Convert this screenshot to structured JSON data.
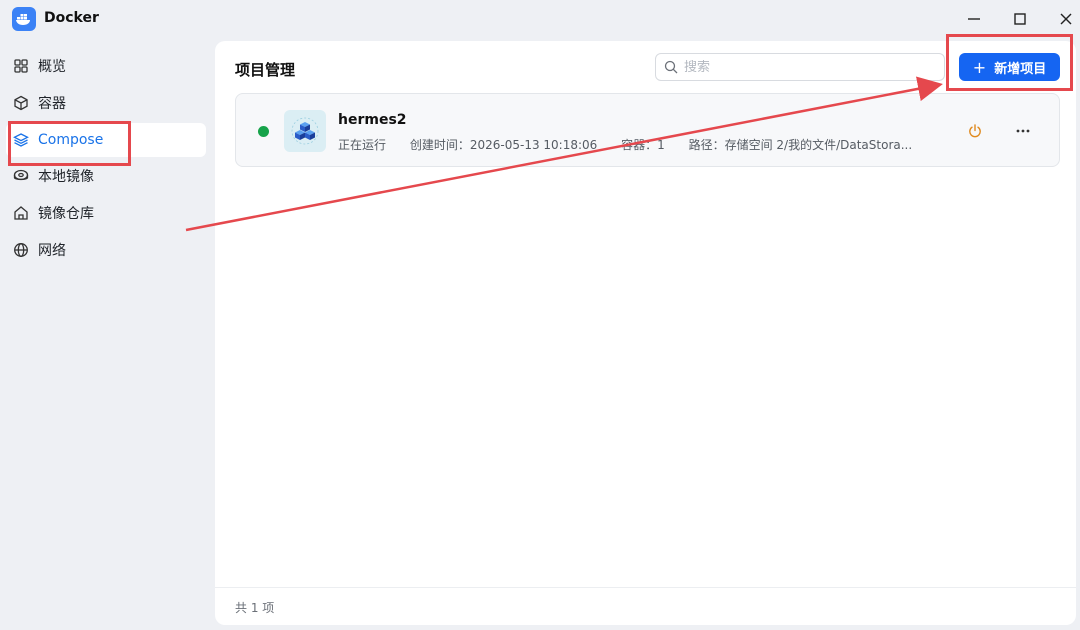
{
  "window": {
    "title": "Docker",
    "controls": {
      "minimize": "minimize",
      "maximize": "maximize",
      "close": "close"
    }
  },
  "sidebar": {
    "items": [
      {
        "label": "概览",
        "icon": "grid-icon"
      },
      {
        "label": "容器",
        "icon": "cube-icon"
      },
      {
        "label": "Compose",
        "icon": "layers-icon",
        "active": true
      },
      {
        "label": "本地镜像",
        "icon": "disk-icon"
      },
      {
        "label": "镜像仓库",
        "icon": "house-icon"
      },
      {
        "label": "网络",
        "icon": "globe-icon"
      }
    ]
  },
  "main": {
    "title": "项目管理",
    "search": {
      "placeholder": "搜索",
      "value": ""
    },
    "add_button": {
      "label": "新增项目",
      "plus": "+"
    },
    "projects": [
      {
        "name": "hermes2",
        "status_color": "#16a34a",
        "status": "正在运行",
        "created": "创建时间：2026-05-13 10:18:06",
        "containers": "容器：1",
        "path": "路径：存储空间 2/我的文件/DataStora..."
      }
    ],
    "footer": "共 1 项"
  },
  "colors": {
    "accent": "#1565f2",
    "active_nav": "#1a73e8",
    "annotation": "#e5484d",
    "power": "#e08a1e"
  }
}
